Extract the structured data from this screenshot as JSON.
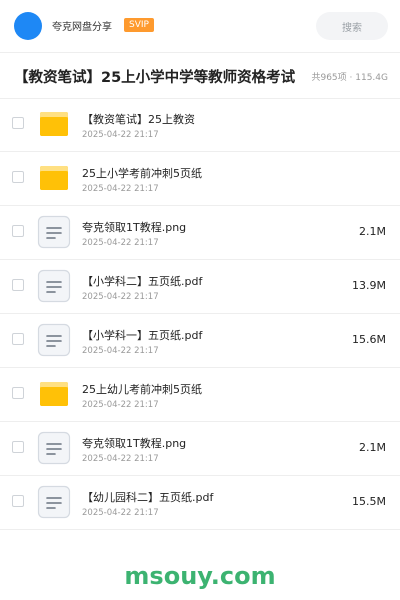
{
  "header": {
    "user_name": "夸克网盘分享",
    "badge": "SVIP",
    "search_placeholder": "搜索"
  },
  "folder": {
    "title": "【教资笔试】25上小学中学等教师资格考试",
    "stats": "共965项 · 115.4G"
  },
  "files": [
    {
      "type": "folder",
      "icon": "folder-icon",
      "name": "【教资笔试】25上教资",
      "date": "2025-04-22 21:17",
      "size": ""
    },
    {
      "type": "folder",
      "icon": "folder-icon",
      "name": "25上小学考前冲刺5页纸",
      "date": "2025-04-22 21:17",
      "size": ""
    },
    {
      "type": "file",
      "icon": "document-icon",
      "name": "夸克领取1T教程.png",
      "date": "2025-04-22 21:17",
      "size": "2.1M"
    },
    {
      "type": "file",
      "icon": "document-icon",
      "name": "【小学科二】五页纸.pdf",
      "date": "2025-04-22 21:17",
      "size": "13.9M"
    },
    {
      "type": "file",
      "icon": "document-icon",
      "name": "【小学科一】五页纸.pdf",
      "date": "2025-04-22 21:17",
      "size": "15.6M"
    },
    {
      "type": "folder",
      "icon": "folder-icon",
      "name": "25上幼儿考前冲刺5页纸",
      "date": "2025-04-22 21:17",
      "size": ""
    },
    {
      "type": "file",
      "icon": "document-icon",
      "name": "夸克领取1T教程.png",
      "date": "2025-04-22 21:17",
      "size": "2.1M"
    },
    {
      "type": "file",
      "icon": "document-icon",
      "name": "【幼儿园科二】五页纸.pdf",
      "date": "2025-04-22 21:17",
      "size": "15.5M"
    }
  ],
  "watermark": "msouy.com",
  "colors": {
    "avatar": "#1e88f5",
    "svip_badge": "#fe9a2e",
    "folder": "#ffc107",
    "watermark": "#3cb371"
  }
}
